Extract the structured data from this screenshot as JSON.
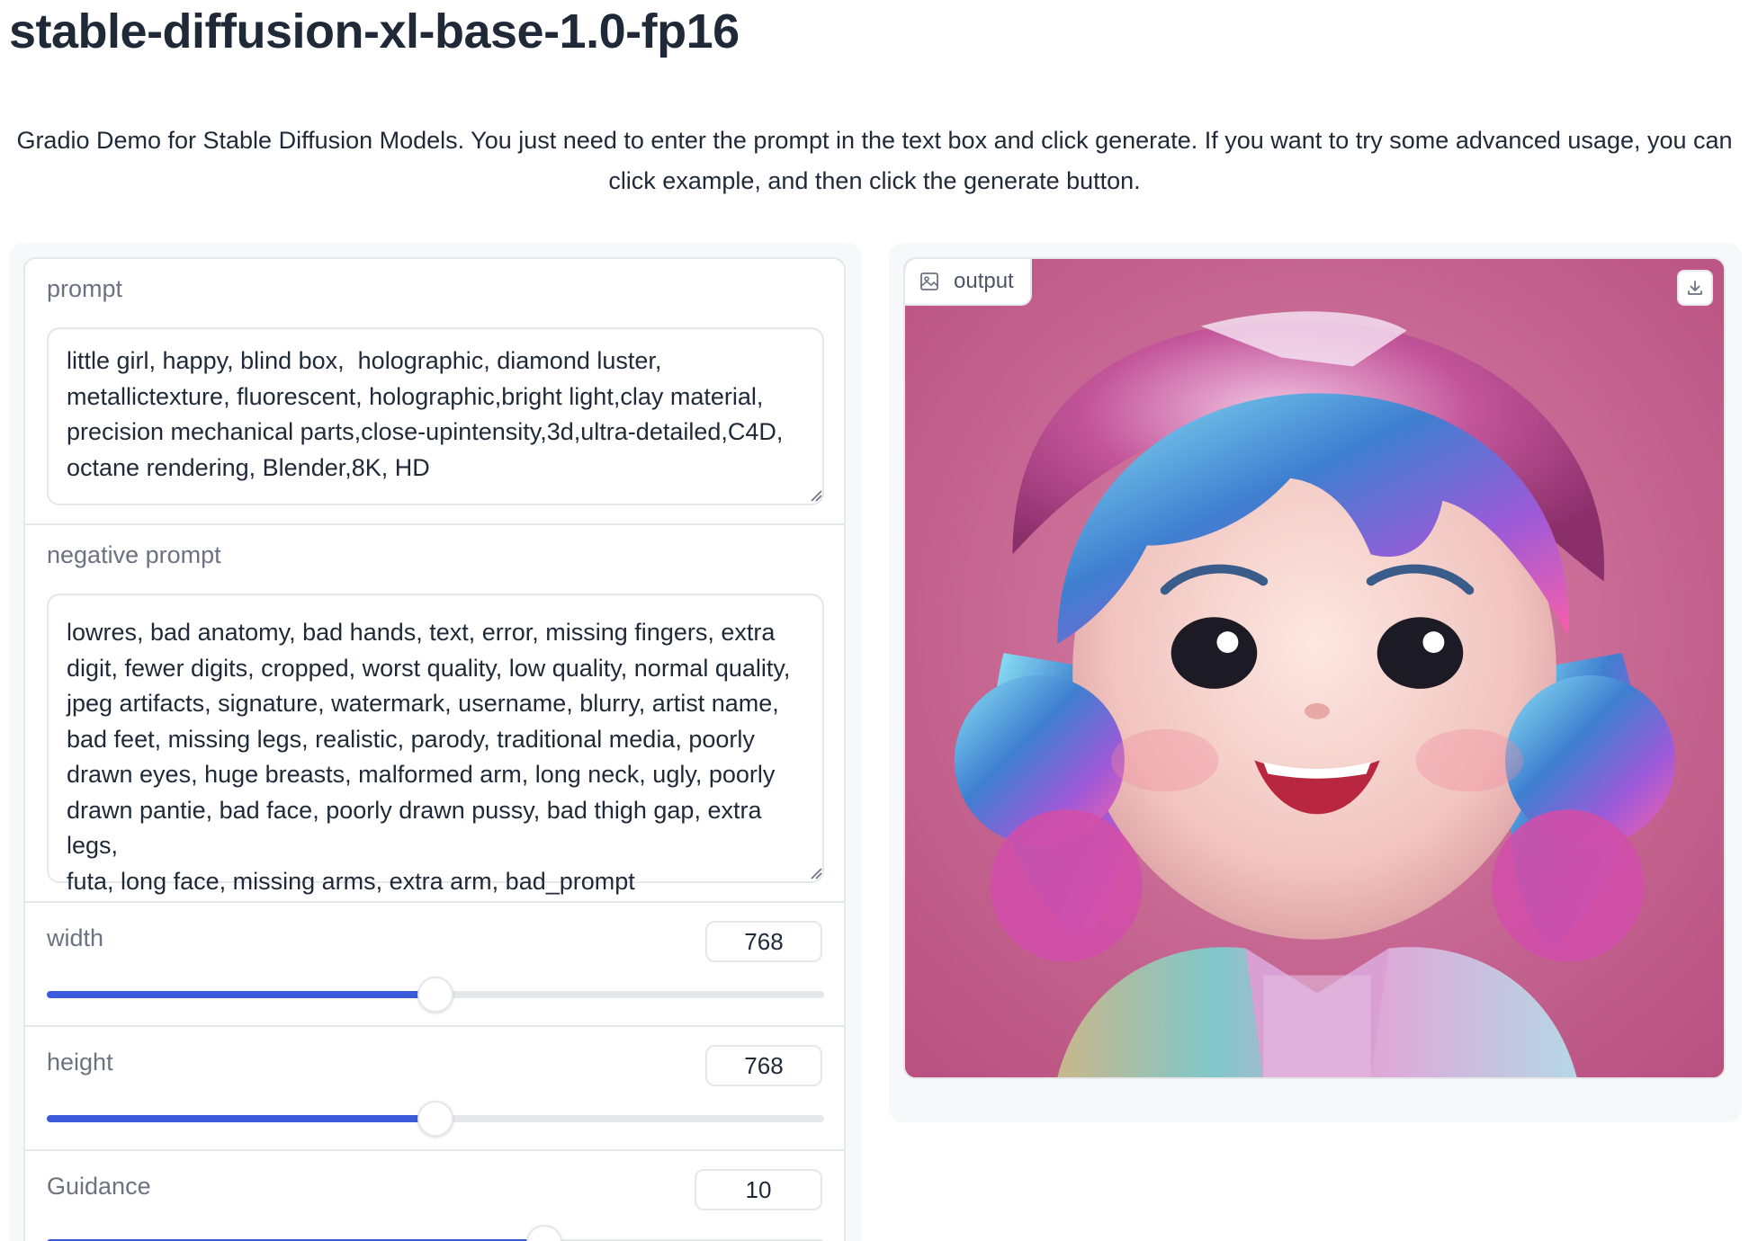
{
  "header": {
    "title": "stable-diffusion-xl-base-1.0-fp16",
    "description": "Gradio Demo for Stable Diffusion Models. You just need to enter the prompt in the text box and click generate. If you want to try some advanced usage, you can click example, and then click the generate button."
  },
  "controls": {
    "prompt": {
      "label": "prompt",
      "value": "little girl, happy, blind box,  holographic, diamond luster,\nmetallictexture, fluorescent, holographic,bright light,clay material,\nprecision mechanical parts,close-upintensity,3d,ultra-detailed,C4D,\noctane rendering, Blender,8K, HD"
    },
    "negative_prompt": {
      "label": "negative prompt",
      "value": "lowres, bad anatomy, bad hands, text, error, missing fingers, extra\ndigit, fewer digits, cropped, worst quality, low quality, normal quality,\njpeg artifacts, signature, watermark, username, blurry, artist name,\nbad feet, missing legs, realistic, parody, traditional media, poorly\ndrawn eyes, huge breasts, malformed arm, long neck, ugly, poorly\ndrawn pantie, bad face, poorly drawn pussy, bad thigh gap, extra legs,\nfuta, long face, missing arms, extra arm, bad_prompt"
    },
    "width": {
      "label": "width",
      "value": "768",
      "fraction": 0.5
    },
    "height": {
      "label": "height",
      "value": "768",
      "fraction": 0.5
    },
    "guidance": {
      "label": "Guidance",
      "value": "10",
      "fraction": 0.64
    }
  },
  "output": {
    "label": "output",
    "image_icon": "image-icon",
    "download_icon": "download-icon"
  },
  "colors": {
    "accent": "#3b5bdb",
    "image_background": "#c86a96"
  }
}
